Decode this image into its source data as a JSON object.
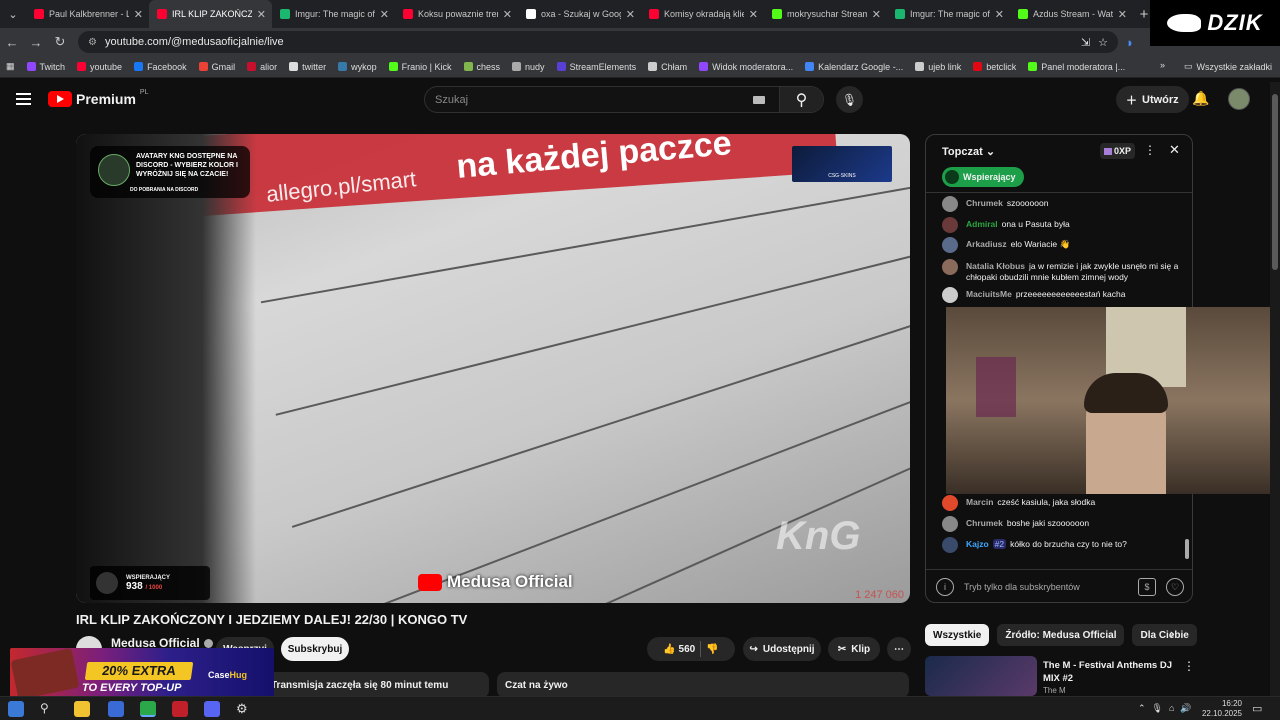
{
  "browser": {
    "tabs": [
      {
        "title": "Paul Kalkbrenner - Live",
        "color": "#ff0033"
      },
      {
        "title": "IRL KLIP ZAKOŃCZONY",
        "color": "#ff0033",
        "active": true
      },
      {
        "title": "Imgur: The magic of the",
        "color": "#1bb76e"
      },
      {
        "title": "Koksu powaznie trenuje",
        "color": "#ff0033"
      },
      {
        "title": "oxa - Szukaj w Google",
        "color": "#ffffff"
      },
      {
        "title": "Komisy okradają klientów",
        "color": "#ff0033"
      },
      {
        "title": "mokrysuchar Stream",
        "color": "#53fc18"
      },
      {
        "title": "Imgur: The magic of the",
        "color": "#1bb76e"
      },
      {
        "title": "Azdus Stream - Watch",
        "color": "#53fc18"
      }
    ],
    "url": "youtube.com/@medusaoficjalnie/live",
    "bookmarks": [
      {
        "label": "Twitch",
        "color": "#9146ff"
      },
      {
        "label": "youtube",
        "color": "#ff0033"
      },
      {
        "label": "Facebook",
        "color": "#1877f2"
      },
      {
        "label": "Gmail",
        "color": "#ea4335"
      },
      {
        "label": "alior",
        "color": "#c8102e"
      },
      {
        "label": "twitter",
        "color": "#dddddd"
      },
      {
        "label": "wykop",
        "color": "#367aa9"
      },
      {
        "label": "Franio | Kick",
        "color": "#53fc18"
      },
      {
        "label": "chess",
        "color": "#81b64c"
      },
      {
        "label": "nudy",
        "color": "#aaaaaa"
      },
      {
        "label": "StreamElements",
        "color": "#5a3fd6"
      },
      {
        "label": "Chłam",
        "color": "#cccccc"
      },
      {
        "label": "Widok moderatora...",
        "color": "#9146ff"
      },
      {
        "label": "Kalendarz Google -...",
        "color": "#4285f4"
      },
      {
        "label": "ujeb link",
        "color": "#cccccc"
      },
      {
        "label": "betclick",
        "color": "#e30613"
      },
      {
        "label": "Panel moderatora |...",
        "color": "#53fc18"
      }
    ],
    "all_bookmarks": "Wszystkie zakładki",
    "corner_logo": "DZIK"
  },
  "youtube": {
    "logo_text": "Premium",
    "logo_region": "PL",
    "search_placeholder": "Szukaj",
    "create_label": "Utwórz"
  },
  "video": {
    "overlay_avatars": "AVATARY KNG DOSTĘPNE NA DISCORD - WYBIERZ KOLOR I WYRÓŻNIJ SIĘ NA CZACIE!",
    "overlay_download": "DO POBRANIA NA DISCORD",
    "street_text": "na każdej paczce",
    "street_url": "allegro.pl/smart",
    "csgo_badge": "CSG·SKINS",
    "supporters_label": "WSPIERAJĄCY",
    "supporters_count": "938",
    "supporters_goal": "/ 1000",
    "brand": "Medusa Official",
    "watermark": "KnG",
    "corner_number": "1 247 060",
    "title": "IRL KLIP ZAKOŃCZONY I JEDZIEMY DALEJ! 22/30 | KONGO TV",
    "channel": "Medusa Official",
    "support_btn": "Wesprzyj",
    "subscribe_btn": "Subskrybuj",
    "likes": "560",
    "share_btn": "Udostępnij",
    "clip_btn": "Klip",
    "started": "Transmisja zaczęła się 80 minut temu",
    "live_chat_label": "Czat na żywo"
  },
  "chat": {
    "mode": "Topczat",
    "xp": "0XP",
    "supporting_btn": "Wspierający",
    "messages": [
      {
        "author": "Chrumek",
        "text": "szoooooon",
        "color": "#aaaaaa",
        "av": "#888888"
      },
      {
        "author": "Admiral",
        "text": "ona u Pasuta była",
        "color": "#2ba640",
        "av": "#6a3a3a"
      },
      {
        "author": "Arkadiusz",
        "text": "elo Wariacie 👋",
        "color": "#aaaaaa",
        "av": "#5a6a8a"
      },
      {
        "author": "Natalia Kłobus",
        "text": "ja w remizie i jak zwykle usnęło mi się a chłopaki obudzili mnie kubłem zimnej wody",
        "color": "#aaaaaa",
        "av": "#8a6a5a"
      },
      {
        "author": "MaciuitsMe",
        "text": "przeeeeeeeeeeeestań kacha",
        "color": "#aaaaaa",
        "av": "#cccccc"
      },
      {
        "author": "Marcin",
        "text": "cześć kasiula, jaka słodka",
        "color": "#aaaaaa",
        "av": "#e04a2a"
      },
      {
        "author": "Chrumek",
        "text": "boshe jaki szoooooon",
        "color": "#aaaaaa",
        "av": "#888888"
      },
      {
        "author": "Kajzo",
        "text": "kółko do brzucha czy to nie to?",
        "color": "#3ea6ff",
        "av": "#3a4a6a",
        "badge": "#2"
      }
    ],
    "input_placeholder": "Tryb tylko dla subskrybentów"
  },
  "chips": [
    "Wszystkie",
    "Źródło: Medusa Official",
    "Dla Ciebie"
  ],
  "recommendation": {
    "title": "The M - Festival Anthems DJ MIX #2",
    "channel": "The M"
  },
  "promo": {
    "headline": "20% EXTRA",
    "subline": "TO EVERY TOP-UP",
    "brand_a": "Case",
    "brand_b": "Hug"
  },
  "taskbar": {
    "time": "16:20",
    "date": "22.10.2025"
  }
}
